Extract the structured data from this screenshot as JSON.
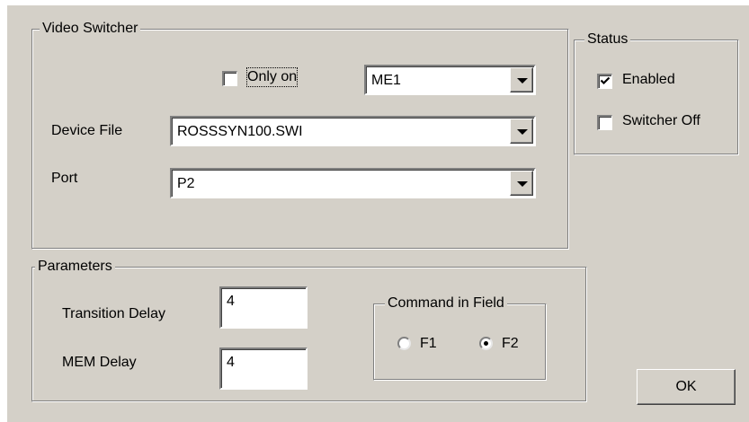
{
  "video_switcher": {
    "title": "Video Switcher",
    "only_on": {
      "label": "Only on",
      "checked": false
    },
    "me_combo": {
      "value": "ME1"
    },
    "device_file": {
      "label": "Device File",
      "value": "ROSSSYN100.SWI"
    },
    "port": {
      "label": "Port",
      "value": "P2"
    }
  },
  "status": {
    "title": "Status",
    "enabled": {
      "label": "Enabled",
      "checked": true
    },
    "switcher_off": {
      "label": "Switcher Off",
      "checked": false
    }
  },
  "parameters": {
    "title": "Parameters",
    "transition_delay": {
      "label": "Transition Delay",
      "value": "4"
    },
    "mem_delay": {
      "label": "MEM Delay",
      "value": "4"
    },
    "command_in_field": {
      "title": "Command in Field",
      "options": [
        {
          "label": "F1",
          "selected": false
        },
        {
          "label": "F2",
          "selected": true
        }
      ]
    }
  },
  "ok_button": {
    "label": "OK"
  },
  "icons": {
    "combo_arrow": "chevron-down-icon",
    "check": "checkmark-icon",
    "radio_dot": "radio-selected-dot"
  }
}
